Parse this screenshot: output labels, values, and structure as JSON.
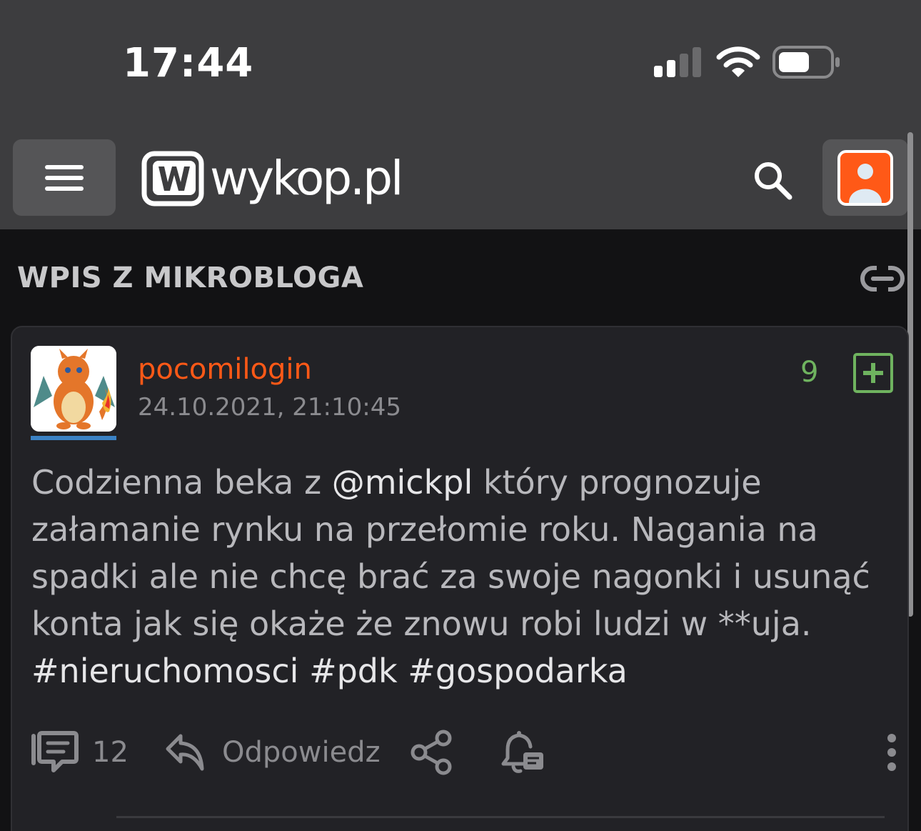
{
  "status_bar": {
    "time": "17:44",
    "icons": [
      "cellular-signal-icon",
      "wifi-icon",
      "battery-icon"
    ]
  },
  "navbar": {
    "menu_icon": "hamburger-menu-icon",
    "logo_text": "wykop.pl",
    "search_icon": "search-icon",
    "profile_icon": "user-avatar-icon",
    "colors": {
      "brand": "#ff5917",
      "bar": "#3d3d3f"
    }
  },
  "section": {
    "title": "WPIS Z MIKROBLOGA",
    "link_icon": "link-icon"
  },
  "post": {
    "author": "pocomilogin",
    "date": "24.10.2021, 21:10:45",
    "votes": "9",
    "body_parts": {
      "p1": "Codzienna beka z ",
      "mention": "@mickpl",
      "p2": " który prognozuje załamanie rynku na przełomie roku. Nagania na spadki ale nie chcę brać za swoje nagonki i usunąć konta jak się okaże że znowu robi ludzi w **uja. ",
      "tag1": "#nieruchomosci",
      "tag2": "#pdk",
      "tag3": "#gospodarka"
    },
    "actions": {
      "comments_count": "12",
      "reply_label": "Odpowiedz",
      "icons": [
        "comments-icon",
        "reply-icon",
        "share-icon",
        "notify-icon",
        "more-icon"
      ]
    },
    "colors": {
      "author": "#ff5917",
      "vote": "#6fb35f",
      "avatar_underline": "#3b82c4"
    }
  }
}
